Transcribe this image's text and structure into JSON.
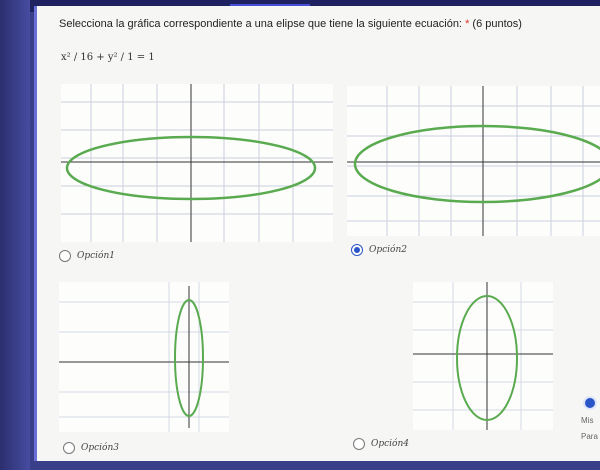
{
  "question": {
    "text": "Selecciona la gráfica correspondiente a una elipse que tiene la siguiente ecuación:",
    "required_mark": "*",
    "points": "(6 puntos)",
    "formula": "x² / 16 + y² / 1 = 1"
  },
  "options": [
    {
      "label": "Opción1",
      "selected": false
    },
    {
      "label": "Opción2",
      "selected": true
    },
    {
      "label": "Opción3",
      "selected": false
    },
    {
      "label": "Opción4",
      "selected": false
    }
  ],
  "side_panel": {
    "line1": "Mis",
    "line2": "Para"
  },
  "colors": {
    "ellipse": "#5aaa50",
    "grid": "#c9d0dc",
    "axis": "#333333",
    "accent": "#2a55c8"
  }
}
